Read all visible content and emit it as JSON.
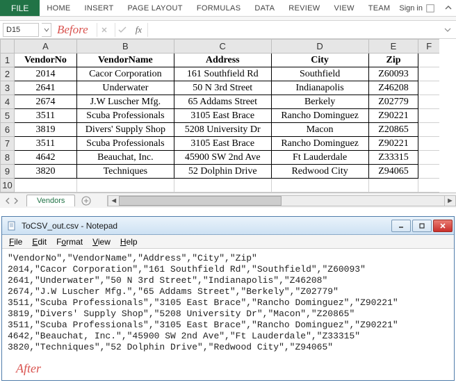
{
  "ribbon": {
    "file": "FILE",
    "tabs": [
      "HOME",
      "INSERT",
      "PAGE LAYOUT",
      "FORMULAS",
      "DATA",
      "REVIEW",
      "VIEW",
      "TEAM"
    ],
    "signin": "Sign in"
  },
  "namebox": {
    "cell": "D15"
  },
  "labels": {
    "before": "Before",
    "after": "After",
    "fx": "fx"
  },
  "columns": [
    "A",
    "B",
    "C",
    "D",
    "E",
    "F"
  ],
  "header_row": [
    "VendorNo",
    "VendorName",
    "Address",
    "City",
    "Zip"
  ],
  "rows": [
    [
      "2014",
      "Cacor Corporation",
      "161 Southfield Rd",
      "Southfield",
      "Z60093"
    ],
    [
      "2641",
      "Underwater",
      "50 N 3rd Street",
      "Indianapolis",
      "Z46208"
    ],
    [
      "2674",
      "J.W Luscher Mfg.",
      "65 Addams Street",
      "Berkely",
      "Z02779"
    ],
    [
      "3511",
      "Scuba Professionals",
      "3105 East Brace",
      "Rancho Dominguez",
      "Z90221"
    ],
    [
      "3819",
      "Divers' Supply Shop",
      "5208 University Dr",
      "Macon",
      "Z20865"
    ],
    [
      "3511",
      "Scuba Professionals",
      "3105 East Brace",
      "Rancho Dominguez",
      "Z90221"
    ],
    [
      "4642",
      "Beauchat, Inc.",
      "45900 SW 2nd Ave",
      "Ft Lauderdale",
      "Z33315"
    ],
    [
      "3820",
      "Techniques",
      "52 Dolphin Drive",
      "Redwood City",
      "Z94065"
    ]
  ],
  "row_nums": [
    "1",
    "2",
    "3",
    "4",
    "5",
    "6",
    "7",
    "8",
    "9",
    "10"
  ],
  "sheet": {
    "name": "Vendors"
  },
  "notepad": {
    "title": "ToCSV_out.csv - Notepad",
    "menu": [
      "File",
      "Edit",
      "Format",
      "View",
      "Help"
    ],
    "lines": [
      "\"VendorNo\",\"VendorName\",\"Address\",\"City\",\"Zip\"",
      "2014,\"Cacor Corporation\",\"161 Southfield Rd\",\"Southfield\",\"Z60093\"",
      "2641,\"Underwater\",\"50 N 3rd Street\",\"Indianapolis\",\"Z46208\"",
      "2674,\"J.W Luscher Mfg.\",\"65 Addams Street\",\"Berkely\",\"Z02779\"",
      "3511,\"Scuba Professionals\",\"3105 East Brace\",\"Rancho Dominguez\",\"Z90221\"",
      "3819,\"Divers' Supply Shop\",\"5208 University Dr\",\"Macon\",\"Z20865\"",
      "3511,\"Scuba Professionals\",\"3105 East Brace\",\"Rancho Dominguez\",\"Z90221\"",
      "4642,\"Beauchat, Inc.\",\"45900 SW 2nd Ave\",\"Ft Lauderdale\",\"Z33315\"",
      "3820,\"Techniques\",\"52 Dolphin Drive\",\"Redwood City\",\"Z94065\""
    ]
  }
}
